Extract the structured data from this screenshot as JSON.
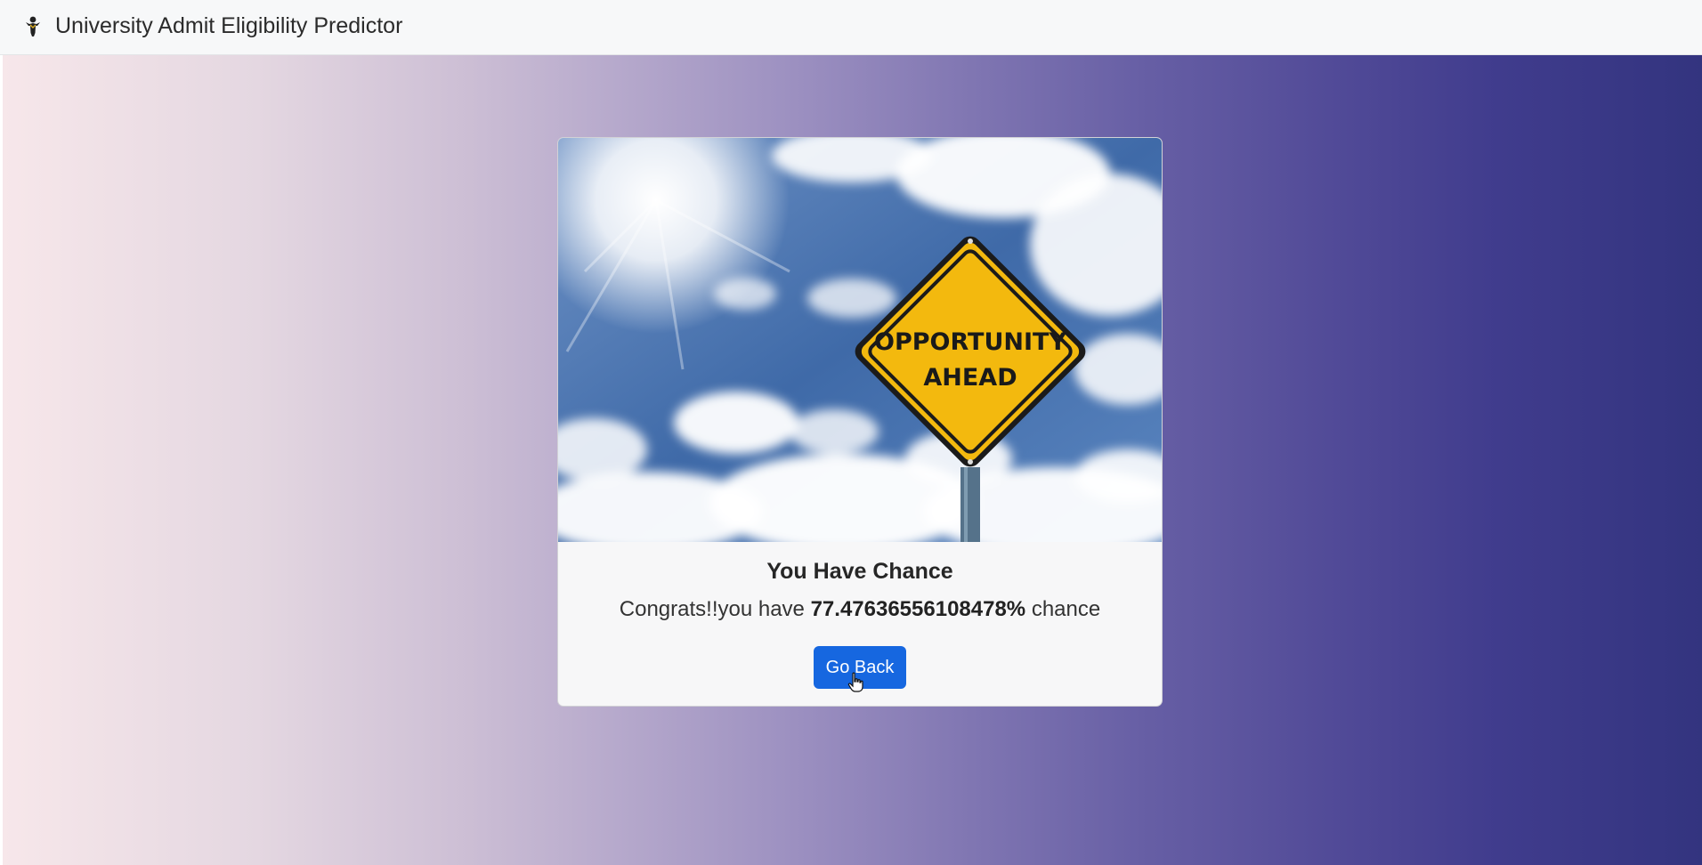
{
  "navbar": {
    "brand_icon": "graduate-person-icon",
    "title": "University Admit Eligibility Predictor"
  },
  "result_card": {
    "image": {
      "description_icon": "opportunity-ahead-sign-image",
      "sign_line_1": "OPPORTUNITY",
      "sign_line_2": "AHEAD"
    },
    "title": "You Have Chance",
    "message_prefix": "Congrats!!you have ",
    "chance_value": "77.47636556108478%",
    "message_suffix": " chance",
    "button_label": "Go Back"
  },
  "colors": {
    "button_bg": "#1667e0",
    "gradient_start": "#f7e7ea",
    "gradient_end": "#33347f",
    "sign_yellow": "#f3b90e"
  }
}
